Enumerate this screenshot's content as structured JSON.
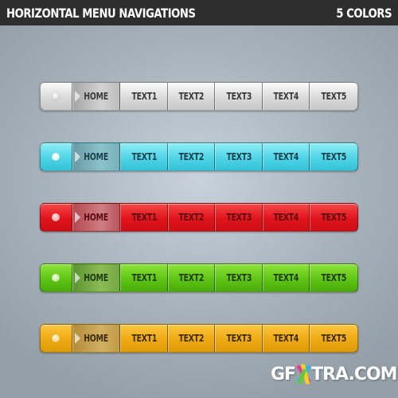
{
  "header": {
    "title": "HORIZONTAL MENU NAVIGATIONS",
    "subtitle": "5 COLORS"
  },
  "menus": [
    {
      "theme": "gray",
      "color": "#d8d8d8",
      "items": [
        "HOME",
        "TEXT1",
        "TEXT2",
        "TEXT3",
        "TEXT4",
        "TEXT5"
      ],
      "active": "HOME"
    },
    {
      "theme": "cyan",
      "color": "#4fd4e6",
      "items": [
        "HOME",
        "TEXT1",
        "TEXT2",
        "TEXT3",
        "TEXT4",
        "TEXT5"
      ],
      "active": "HOME"
    },
    {
      "theme": "red",
      "color": "#e0141b",
      "items": [
        "HOME",
        "TEXT1",
        "TEXT2",
        "TEXT3",
        "TEXT4",
        "TEXT5"
      ],
      "active": "HOME"
    },
    {
      "theme": "green",
      "color": "#5fc514",
      "items": [
        "HOME",
        "TEXT1",
        "TEXT2",
        "TEXT3",
        "TEXT4",
        "TEXT5"
      ],
      "active": "HOME"
    },
    {
      "theme": "yellow",
      "color": "#eeaa12",
      "items": [
        "HOME",
        "TEXT1",
        "TEXT2",
        "TEXT3",
        "TEXT4",
        "TEXT5"
      ],
      "active": "HOME"
    }
  ],
  "watermark": {
    "prefix": "GF",
    "suffix": "TRA.COM"
  }
}
